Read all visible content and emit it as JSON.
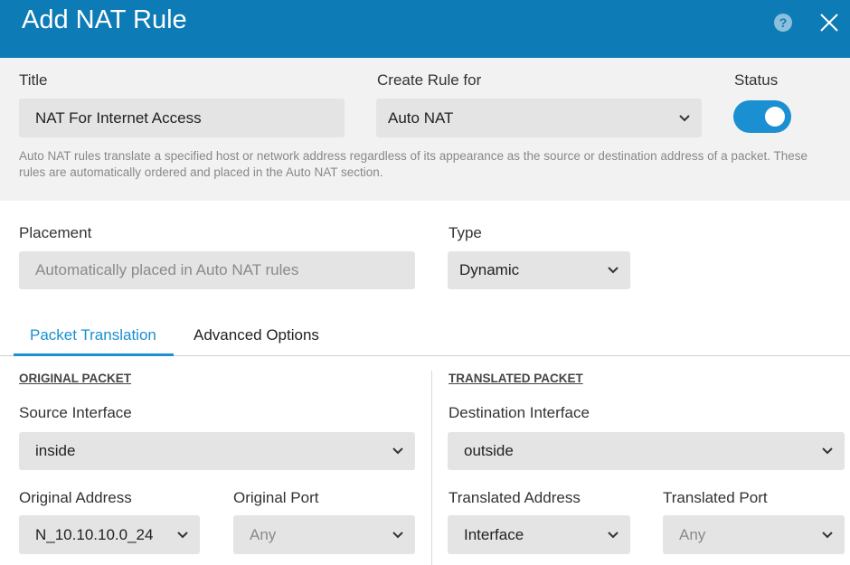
{
  "header": {
    "title": "Add NAT Rule",
    "help_glyph": "?"
  },
  "general": {
    "title_label": "Title",
    "title_value": "NAT For Internet Access",
    "create_rule_for_label": "Create Rule for",
    "create_rule_for_value": "Auto NAT",
    "status_label": "Status",
    "status_enabled": true,
    "help_text": "Auto NAT rules translate a specified host or network address regardless of its appearance as the source or destination address of a packet. These rules are automatically ordered and placed in the Auto NAT section."
  },
  "placement": {
    "placement_label": "Placement",
    "placement_value": "Automatically placed in Auto NAT rules",
    "type_label": "Type",
    "type_value": "Dynamic"
  },
  "tabs": [
    {
      "label": "Packet Translation",
      "active": true
    },
    {
      "label": "Advanced Options",
      "active": false
    }
  ],
  "original_packet": {
    "heading": "ORIGINAL PACKET",
    "source_interface_label": "Source Interface",
    "source_interface_value": "inside",
    "original_address_label": "Original Address",
    "original_address_value": "N_10.10.10.0_24",
    "original_port_label": "Original Port",
    "original_port_value": "Any"
  },
  "translated_packet": {
    "heading": "TRANSLATED PACKET",
    "destination_interface_label": "Destination Interface",
    "destination_interface_value": "outside",
    "translated_address_label": "Translated Address",
    "translated_address_value": "Interface",
    "translated_port_label": "Translated Port",
    "translated_port_value": "Any"
  },
  "colors": {
    "header_bg": "#0d7bb5",
    "accent": "#1a8fd1",
    "field_bg": "#e4e4e4",
    "section_bg": "#f2f2f2"
  },
  "icons": [
    "help-icon",
    "close-icon",
    "chevron-down-icon"
  ]
}
